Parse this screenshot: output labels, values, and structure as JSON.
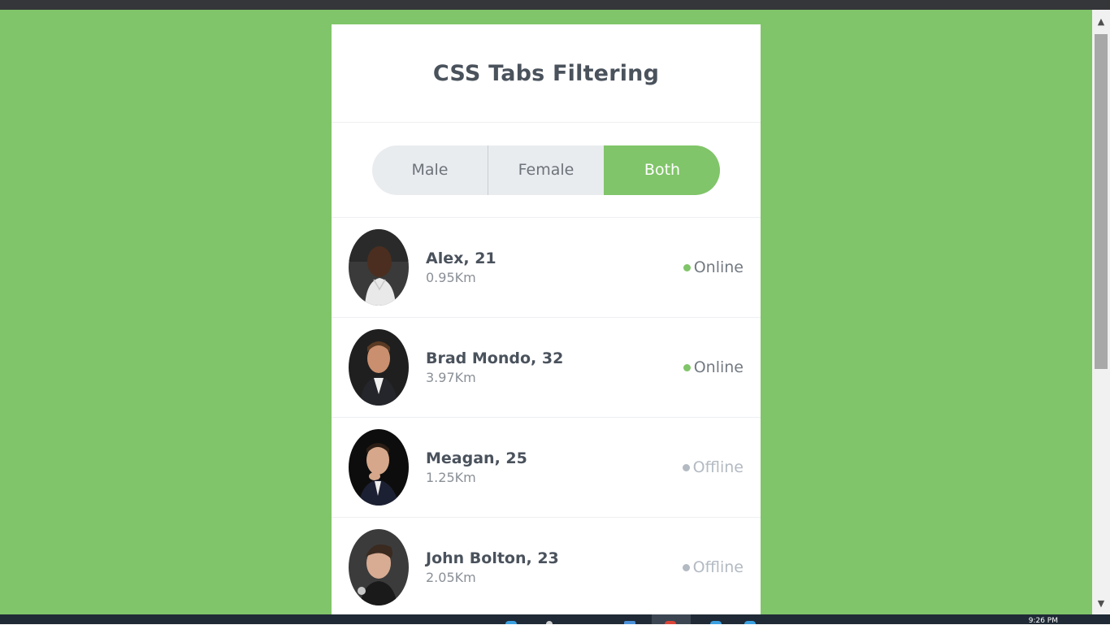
{
  "title": "CSS Tabs Filtering",
  "tabs": [
    {
      "label": "Male",
      "active": false
    },
    {
      "label": "Female",
      "active": false
    },
    {
      "label": "Both",
      "active": true
    }
  ],
  "people": [
    {
      "name": "Alex, 21",
      "distance": "0.95Km",
      "status": "Online"
    },
    {
      "name": "Brad Mondo, 32",
      "distance": "3.97Km",
      "status": "Online"
    },
    {
      "name": "Meagan, 25",
      "distance": "1.25Km",
      "status": "Offline"
    },
    {
      "name": "John Bolton, 23",
      "distance": "2.05Km",
      "status": "Offline"
    }
  ],
  "colors": {
    "accent": "#80c569",
    "title": "#4a525c",
    "online_dot": "#80c569",
    "offline_dot": "#b3bac2"
  },
  "taskbar": {
    "clock": "9:26 PM"
  }
}
